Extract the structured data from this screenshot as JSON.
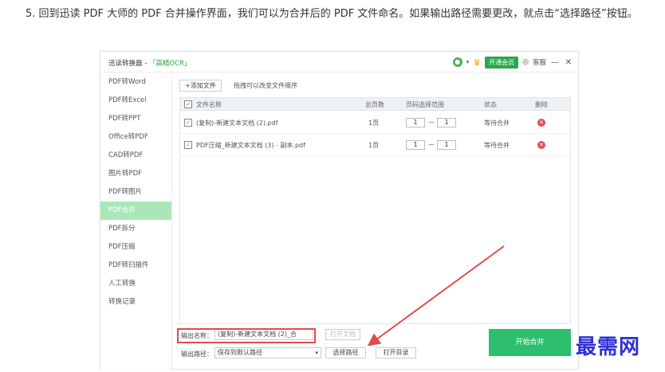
{
  "instruction": "5. 回到迅读 PDF 大师的 PDF 合并操作界面，我们可以为合并后的 PDF 文件命名。如果输出路径需要更改，就点击“选择路径”按钮。",
  "app": {
    "title_prefix": "迅读转换器 - ",
    "title_ocr": "「高精OCR」",
    "vip_label": "开通会员",
    "feedback_label": "客服",
    "minimize": "—",
    "close": "✕"
  },
  "sidebar": {
    "items": [
      {
        "label": "PDF转Word"
      },
      {
        "label": "PDF转Excel"
      },
      {
        "label": "PDF转PPT"
      },
      {
        "label": "Office转PDF"
      },
      {
        "label": "CAD转PDF"
      },
      {
        "label": "图片转PDF"
      },
      {
        "label": "PDF转图片"
      },
      {
        "label": "PDF合并",
        "active": true
      },
      {
        "label": "PDF拆分"
      },
      {
        "label": "PDF压缩"
      },
      {
        "label": "PDF转扫描件"
      },
      {
        "label": "人工转换"
      },
      {
        "label": "转换记录"
      }
    ]
  },
  "toolbar": {
    "add_file_label": "+添加文件",
    "hint": "拖拽可以改变文件顺序"
  },
  "table": {
    "headers": {
      "name": "文件名称",
      "pages": "总页数",
      "range": "页码选择范围",
      "status": "状态",
      "delete": "删除"
    },
    "rows": [
      {
        "name": "(复制)-新建文本文档 (2).pdf",
        "pages": "1页",
        "from": "1",
        "to": "1",
        "sep": "—",
        "status": "等待合并"
      },
      {
        "name": "PDF压缩_新建文本文档 (3) - 副本.pdf",
        "pages": "1页",
        "from": "1",
        "to": "1",
        "sep": "—",
        "status": "等待合并"
      }
    ]
  },
  "output": {
    "name_label": "输出名称：",
    "name_value": "(复制)-新建文本文档 (2)_合",
    "open_file_label": "打开文档",
    "path_label": "输出路径：",
    "path_value": "保存到默认路径",
    "choose_path_label": "选择路径",
    "open_dir_label": "打开目录",
    "start_label": "开始合并"
  },
  "watermark": "最需网",
  "colors": {
    "accent": "#2dbf6e",
    "active_sidebar": "#a9e7b9",
    "highlight": "#e24a4a",
    "watermark": "#2f2fd8"
  }
}
